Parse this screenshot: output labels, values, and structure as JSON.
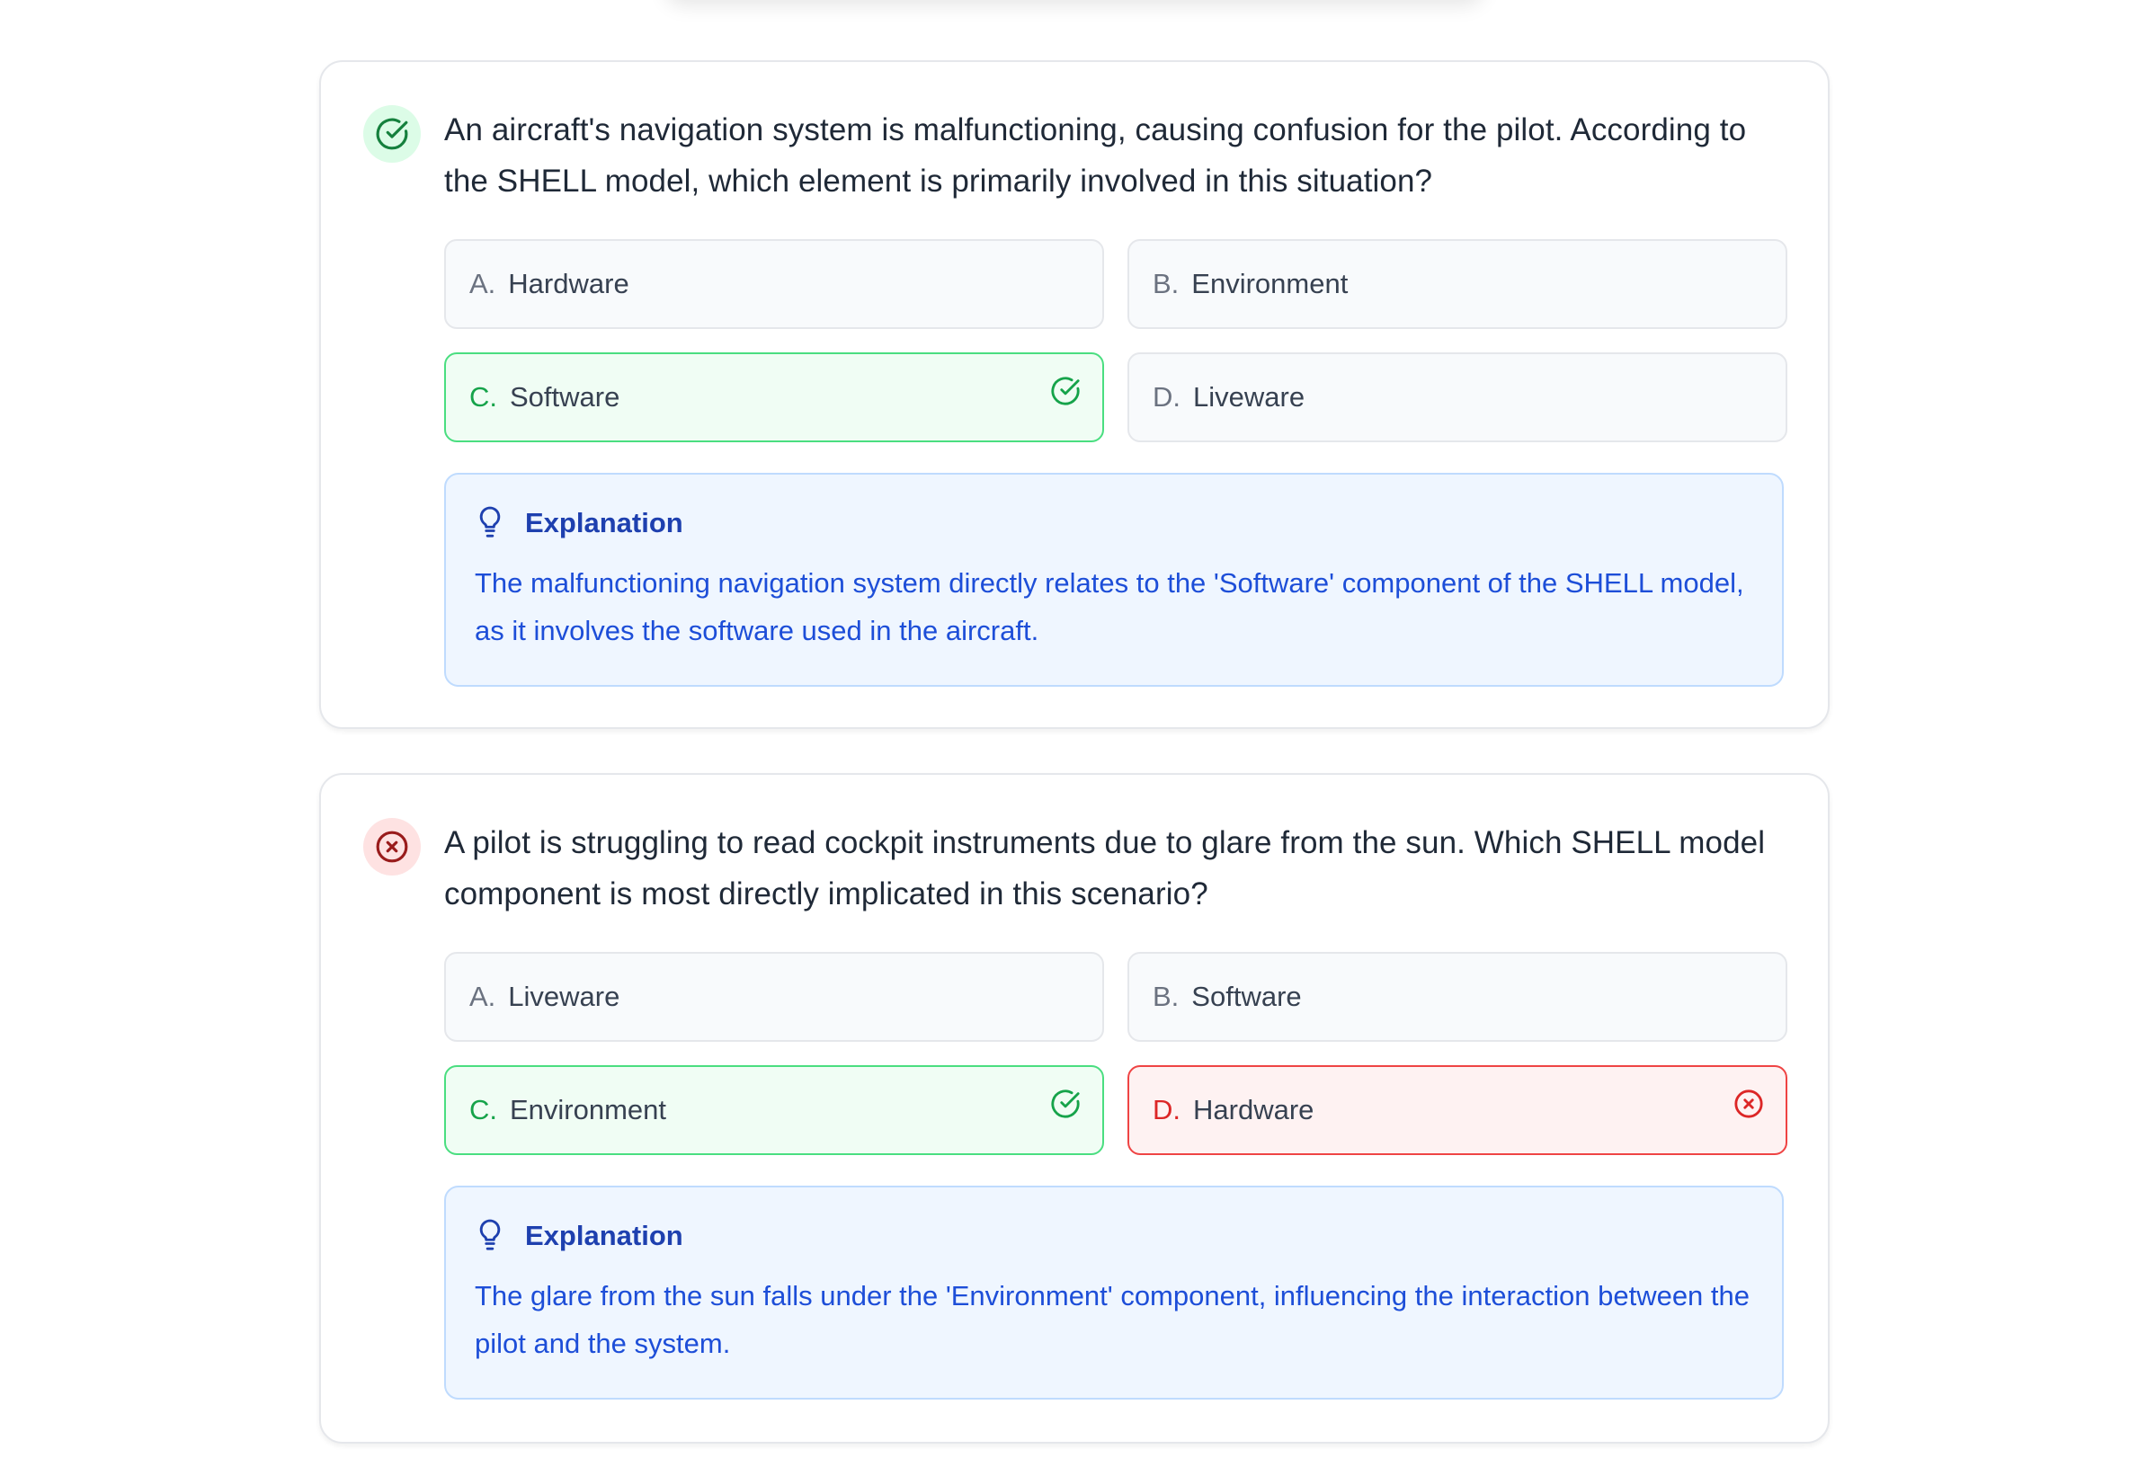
{
  "questions": [
    {
      "status": "correct",
      "status_icon": "check-circle-icon",
      "text": "An aircraft's navigation system is malfunctioning, causing confusion for the pilot. According to the SHELL model, which element is primarily involved in this situation?",
      "options": [
        {
          "letter": "A.",
          "label": "Hardware",
          "state": "default"
        },
        {
          "letter": "B.",
          "label": "Environment",
          "state": "default"
        },
        {
          "letter": "C.",
          "label": "Software",
          "state": "correct"
        },
        {
          "letter": "D.",
          "label": "Liveware",
          "state": "default"
        }
      ],
      "explanation_title": "Explanation",
      "explanation_text": "The malfunctioning navigation system directly relates to the 'Software' component of the SHELL model, as it involves the software used in the aircraft."
    },
    {
      "status": "incorrect",
      "status_icon": "x-circle-icon",
      "text": "A pilot is struggling to read cockpit instruments due to glare from the sun. Which SHELL model component is most directly implicated in this scenario?",
      "options": [
        {
          "letter": "A.",
          "label": "Liveware",
          "state": "default"
        },
        {
          "letter": "B.",
          "label": "Software",
          "state": "default"
        },
        {
          "letter": "C.",
          "label": "Environment",
          "state": "correct"
        },
        {
          "letter": "D.",
          "label": "Hardware",
          "state": "wrong"
        }
      ],
      "explanation_title": "Explanation",
      "explanation_text": "The glare from the sun falls under the 'Environment' component, influencing the interaction between the pilot and the system."
    }
  ],
  "colors": {
    "correct": "#16a34a",
    "incorrect": "#dc2626",
    "explanation": "#1d4ed8"
  }
}
